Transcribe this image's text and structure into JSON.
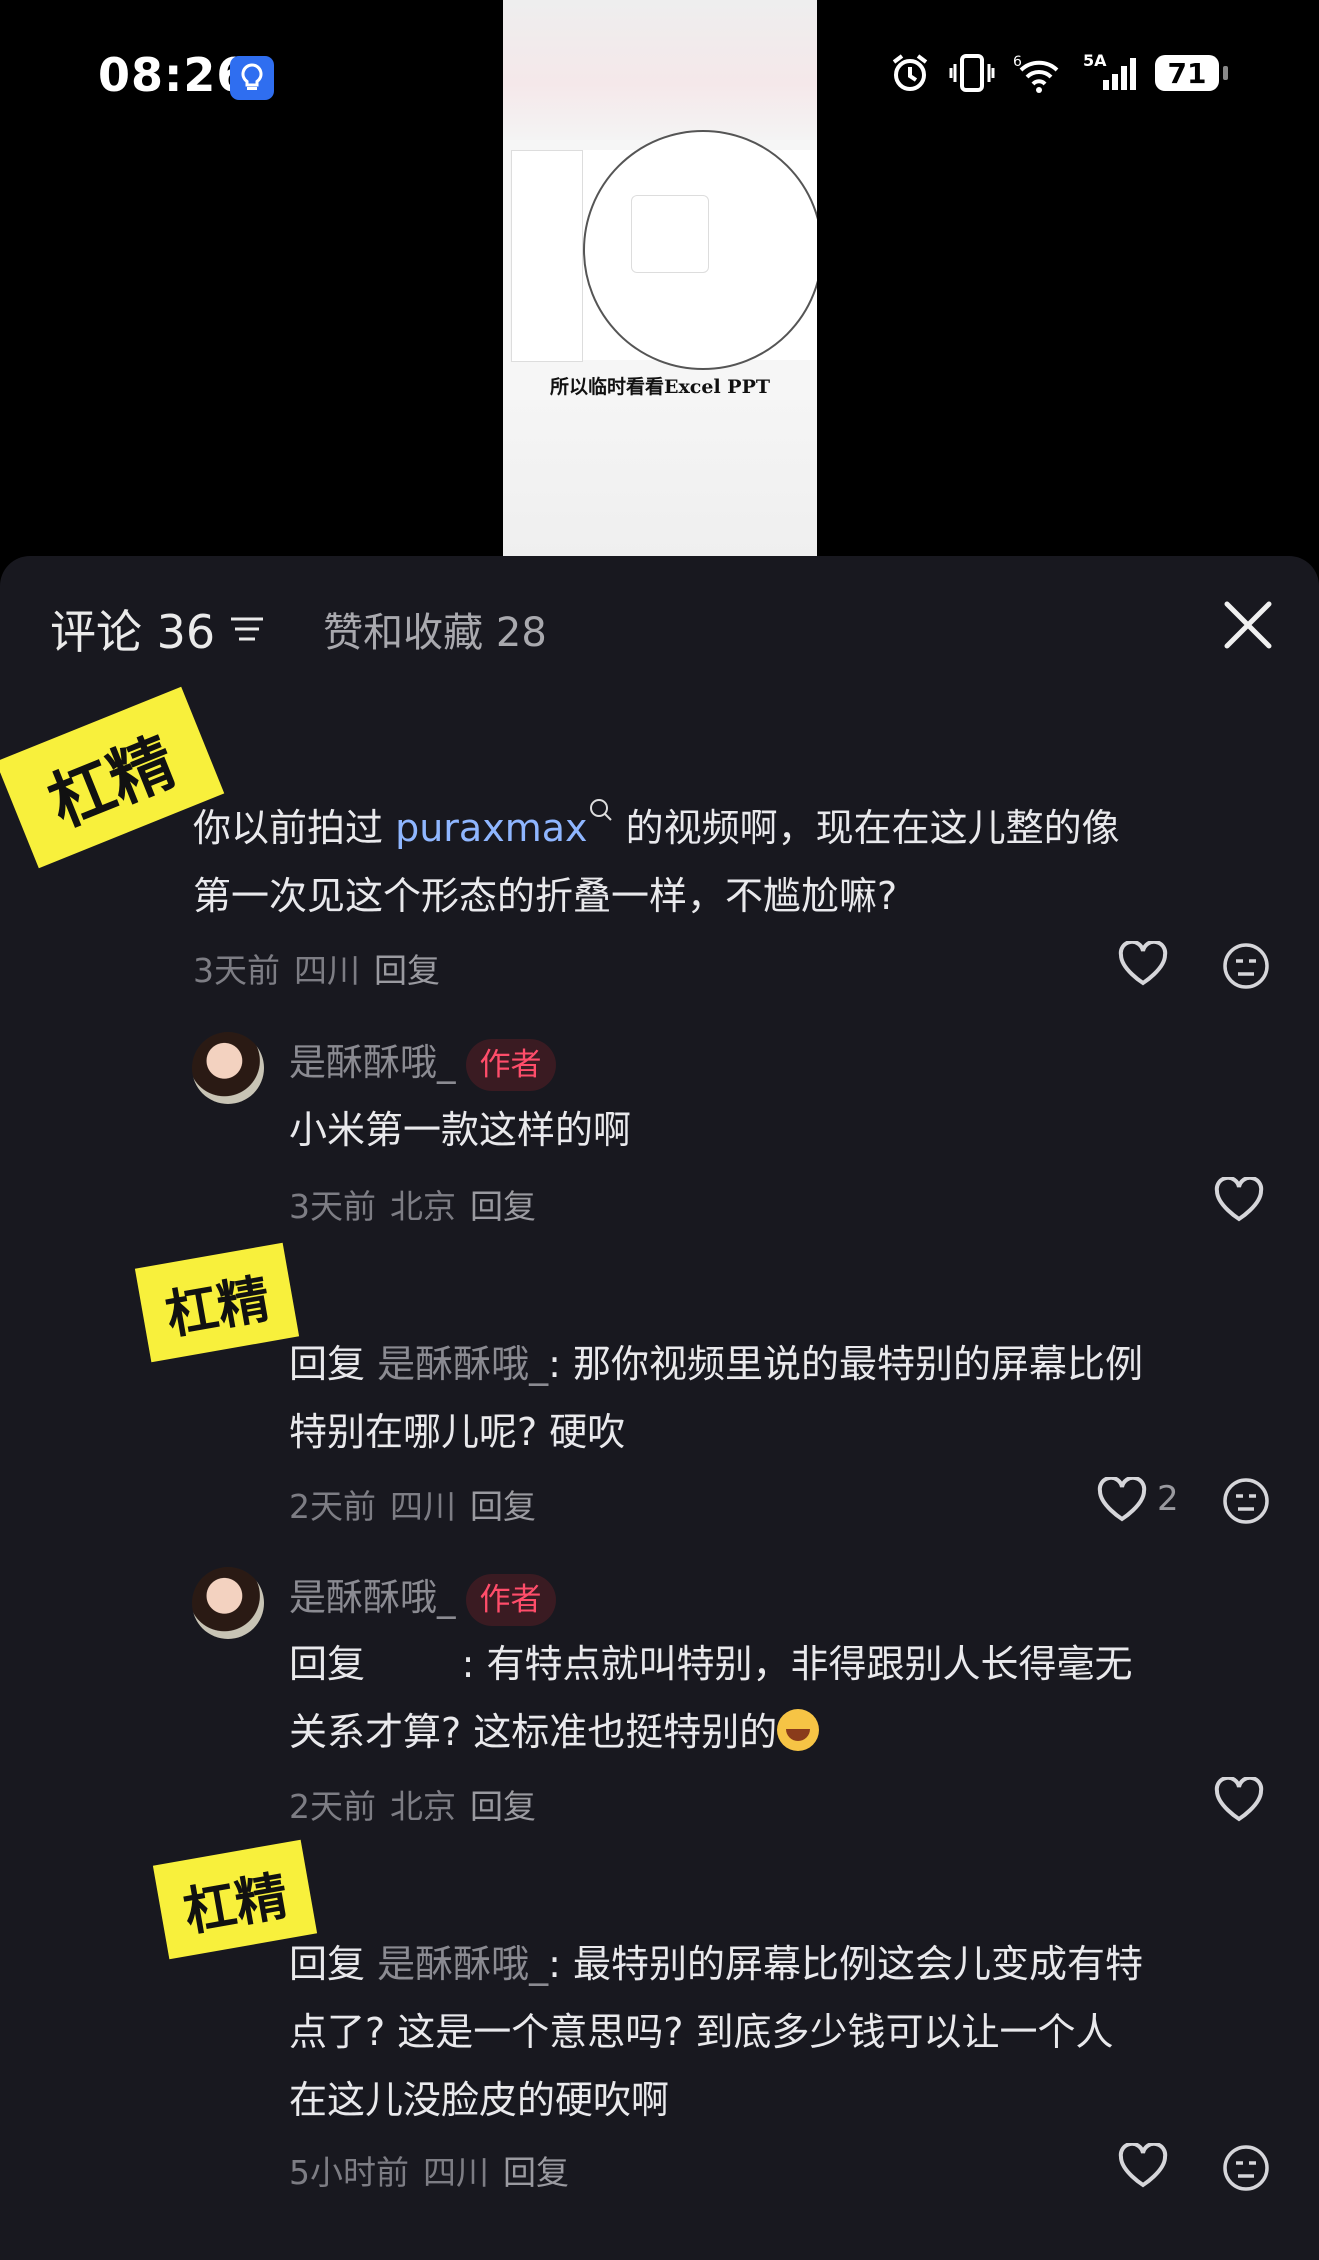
{
  "status_bar": {
    "time": "08:26",
    "network": "5A",
    "signal_prefix": "6",
    "battery": "71"
  },
  "video": {
    "caption": "所以临时看看Excel PPT"
  },
  "header": {
    "comments_tab": "评论 36",
    "likes_tab": "赞和收藏 28"
  },
  "stickers": [
    "杠精",
    "杠精",
    "杠精"
  ],
  "comments": [
    {
      "text_pre": "你以前拍过 ",
      "link": "puraxmax",
      "text_post_line1": " 的视频啊，现在在这儿整的像",
      "text_line2": "第一次见这个形态的折叠一样，不尴尬嘛?",
      "time": "3天前",
      "location": "四川",
      "reply": "回复"
    },
    {
      "name": "是酥酥哦_",
      "badge": "作者",
      "text": "小米第一款这样的啊",
      "time": "3天前",
      "location": "北京",
      "reply": "回复"
    },
    {
      "prefix": "回复 ",
      "mention": "是酥酥哦_",
      "text_line1": ": 那你视频里说的最特别的屏幕比例",
      "text_line2": "特别在哪儿呢? 硬吹",
      "time": "2天前",
      "location": "四川",
      "reply": "回复",
      "likes": "2"
    },
    {
      "name": "是酥酥哦_",
      "badge": "作者",
      "text_line1": "回复        : 有特点就叫特别，非得跟别人长得毫无",
      "text_line2": "关系才算? 这标准也挺特别的",
      "time": "2天前",
      "location": "北京",
      "reply": "回复"
    },
    {
      "prefix": "回复 ",
      "mention": "是酥酥哦_",
      "text_line1": ": 最特别的屏幕比例这会儿变成有特",
      "text_line2": "点了? 这是一个意思吗? 到底多少钱可以让一个人",
      "text_line3": "在这儿没脸皮的硬吹啊",
      "time": "5小时前",
      "location": "四川",
      "reply": "回复"
    }
  ]
}
